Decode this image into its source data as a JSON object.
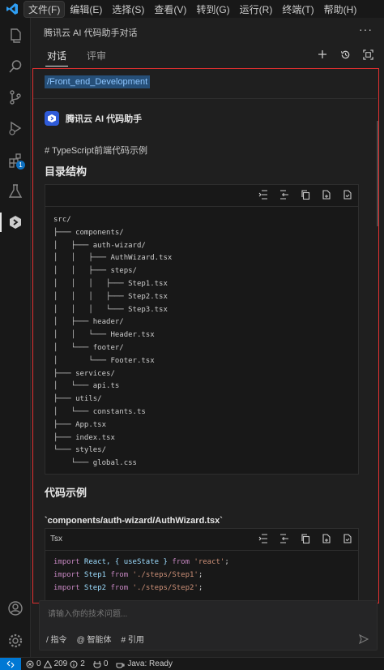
{
  "menubar": {
    "items": [
      "文件(F)",
      "编辑(E)",
      "选择(S)",
      "查看(V)",
      "转到(G)",
      "运行(R)",
      "终端(T)",
      "帮助(H)"
    ]
  },
  "activity_bar": {
    "extensions_badge": "1"
  },
  "panel": {
    "title": "腾讯云 AI 代码助手对话",
    "more": "···",
    "tabs": [
      "对话",
      "评审"
    ]
  },
  "chat": {
    "context_chip": "/Front_end_Development",
    "assistant_name": "腾讯云 AI 代码助手",
    "heading_line": "# TypeScript前端代码示例",
    "section1_title": "目录结构",
    "tree_lines": [
      "src/",
      "├─── components/",
      "│   ├─── auth-wizard/",
      "│   │   ├─── AuthWizard.tsx",
      "│   │   ├─── steps/",
      "│   │   │   ├─── Step1.tsx",
      "│   │   │   ├─── Step2.tsx",
      "│   │   │   └─── Step3.tsx",
      "│   ├─── header/",
      "│   │   └─── Header.tsx",
      "│   └─── footer/",
      "│       └─── Footer.tsx",
      "├─── services/",
      "│   └─── api.ts",
      "├─── utils/",
      "│   └─── constants.ts",
      "├─── App.tsx",
      "├─── index.tsx",
      "└─── styles/",
      "    └─── global.css"
    ],
    "section2_title": "代码示例",
    "file_path": "`components/auth-wizard/AuthWizard.tsx`",
    "code_lang": "Tsx",
    "code_lines": [
      {
        "kw": "import",
        "a": " React, { useState } ",
        "from": "from",
        "str": " 'react'",
        "end": ";"
      },
      {
        "kw": "import",
        "a": " Step1 ",
        "from": "from",
        "str": " './steps/Step1'",
        "end": ";"
      },
      {
        "kw": "import",
        "a": " Step2 ",
        "from": "from",
        "str": " './steps/Step2'",
        "end": ";"
      }
    ]
  },
  "input": {
    "placeholder": "请输入你的技术问题...",
    "tools": [
      "/ 指令",
      "@ 智能体",
      "# 引用"
    ]
  },
  "statusbar": {
    "errors": "0",
    "warnings": "209",
    "info": "2",
    "ports": "0",
    "java": "Java: Ready"
  },
  "colors": {
    "accent": "#0078d4",
    "highlight_border": "#e03030",
    "chip_bg": "#264f78"
  }
}
